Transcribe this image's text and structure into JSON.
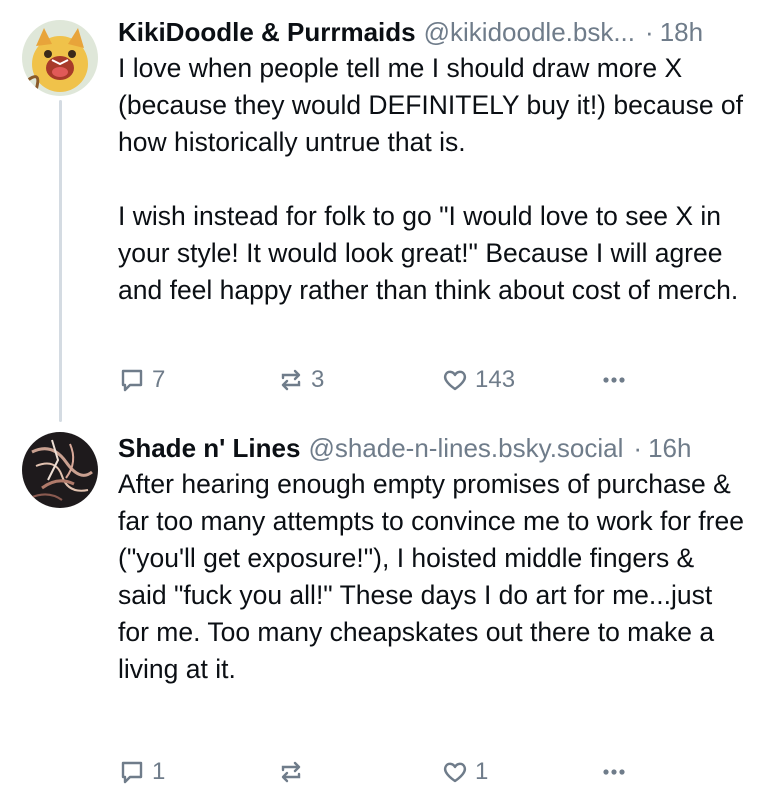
{
  "posts": [
    {
      "author_name": "KikiDoodle & Purrmaids",
      "handle": "@kikidoodle.bsk...",
      "separator": "·",
      "time": "18h",
      "text": "I love when people tell me I should draw more X (because they would DEFINITELY buy it!) because of how historically untrue that is.\n\nI wish instead for folk to go \"I would love to see X in your style! It would look great!\" Because I will agree and feel happy rather than think about cost of merch.",
      "reply_count": "7",
      "repost_count": "3",
      "like_count": "143",
      "avatar_icon": "cat-avatar-icon"
    },
    {
      "author_name": "Shade n' Lines",
      "handle": "@shade-n-lines.bsky.social",
      "separator": "·",
      "time": "16h",
      "text": "After hearing enough empty promises of purchase & far too many attempts to convince me to work for free (\"you'll get exposure!\"), I hoisted middle fingers & said \"fuck you all!\" These days I do art for me...just for me. Too many cheapskates out there to make a living at it.",
      "reply_count": "1",
      "repost_count": "",
      "like_count": "1",
      "avatar_icon": "art-avatar-icon"
    }
  ],
  "colors": {
    "text": "#0b0f14",
    "muted": "#6f7c8a",
    "thread_line": "#d4dbe2"
  }
}
